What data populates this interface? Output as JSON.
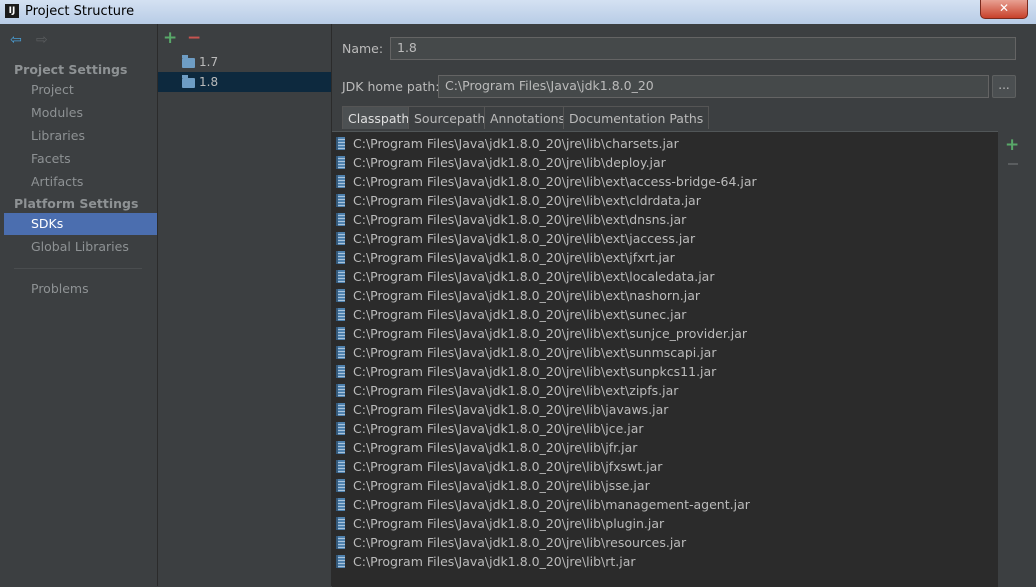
{
  "window": {
    "title": "Project Structure",
    "app_icon": "IJ",
    "close_icon": "✕"
  },
  "nav": {
    "back_icon": "⇦",
    "forward_icon": "⇨",
    "project_settings_title": "Project Settings",
    "project_items": [
      "Project",
      "Modules",
      "Libraries",
      "Facets",
      "Artifacts"
    ],
    "platform_settings_title": "Platform Settings",
    "platform_items": [
      "SDKs",
      "Global Libraries"
    ],
    "selected_item": "SDKs",
    "problems_label": "Problems"
  },
  "sdks": {
    "add_icon": "+",
    "remove_icon": "−",
    "items": [
      "1.7",
      "1.8"
    ],
    "selected": "1.8"
  },
  "main": {
    "name_label": "Name:",
    "name_value": "1.8",
    "home_label": "JDK home path:",
    "home_value": "C:\\Program Files\\Java\\jdk1.8.0_20",
    "browse_label": "...",
    "tabs": [
      "Classpath",
      "Sourcepath",
      "Annotations",
      "Documentation Paths"
    ],
    "active_tab": "Classpath",
    "add_icon": "+",
    "paths": [
      "C:\\Program Files\\Java\\jdk1.8.0_20\\jre\\lib\\charsets.jar",
      "C:\\Program Files\\Java\\jdk1.8.0_20\\jre\\lib\\deploy.jar",
      "C:\\Program Files\\Java\\jdk1.8.0_20\\jre\\lib\\ext\\access-bridge-64.jar",
      "C:\\Program Files\\Java\\jdk1.8.0_20\\jre\\lib\\ext\\cldrdata.jar",
      "C:\\Program Files\\Java\\jdk1.8.0_20\\jre\\lib\\ext\\dnsns.jar",
      "C:\\Program Files\\Java\\jdk1.8.0_20\\jre\\lib\\ext\\jaccess.jar",
      "C:\\Program Files\\Java\\jdk1.8.0_20\\jre\\lib\\ext\\jfxrt.jar",
      "C:\\Program Files\\Java\\jdk1.8.0_20\\jre\\lib\\ext\\localedata.jar",
      "C:\\Program Files\\Java\\jdk1.8.0_20\\jre\\lib\\ext\\nashorn.jar",
      "C:\\Program Files\\Java\\jdk1.8.0_20\\jre\\lib\\ext\\sunec.jar",
      "C:\\Program Files\\Java\\jdk1.8.0_20\\jre\\lib\\ext\\sunjce_provider.jar",
      "C:\\Program Files\\Java\\jdk1.8.0_20\\jre\\lib\\ext\\sunmscapi.jar",
      "C:\\Program Files\\Java\\jdk1.8.0_20\\jre\\lib\\ext\\sunpkcs11.jar",
      "C:\\Program Files\\Java\\jdk1.8.0_20\\jre\\lib\\ext\\zipfs.jar",
      "C:\\Program Files\\Java\\jdk1.8.0_20\\jre\\lib\\javaws.jar",
      "C:\\Program Files\\Java\\jdk1.8.0_20\\jre\\lib\\jce.jar",
      "C:\\Program Files\\Java\\jdk1.8.0_20\\jre\\lib\\jfr.jar",
      "C:\\Program Files\\Java\\jdk1.8.0_20\\jre\\lib\\jfxswt.jar",
      "C:\\Program Files\\Java\\jdk1.8.0_20\\jre\\lib\\jsse.jar",
      "C:\\Program Files\\Java\\jdk1.8.0_20\\jre\\lib\\management-agent.jar",
      "C:\\Program Files\\Java\\jdk1.8.0_20\\jre\\lib\\plugin.jar",
      "C:\\Program Files\\Java\\jdk1.8.0_20\\jre\\lib\\resources.jar",
      "C:\\Program Files\\Java\\jdk1.8.0_20\\jre\\lib\\rt.jar"
    ]
  }
}
